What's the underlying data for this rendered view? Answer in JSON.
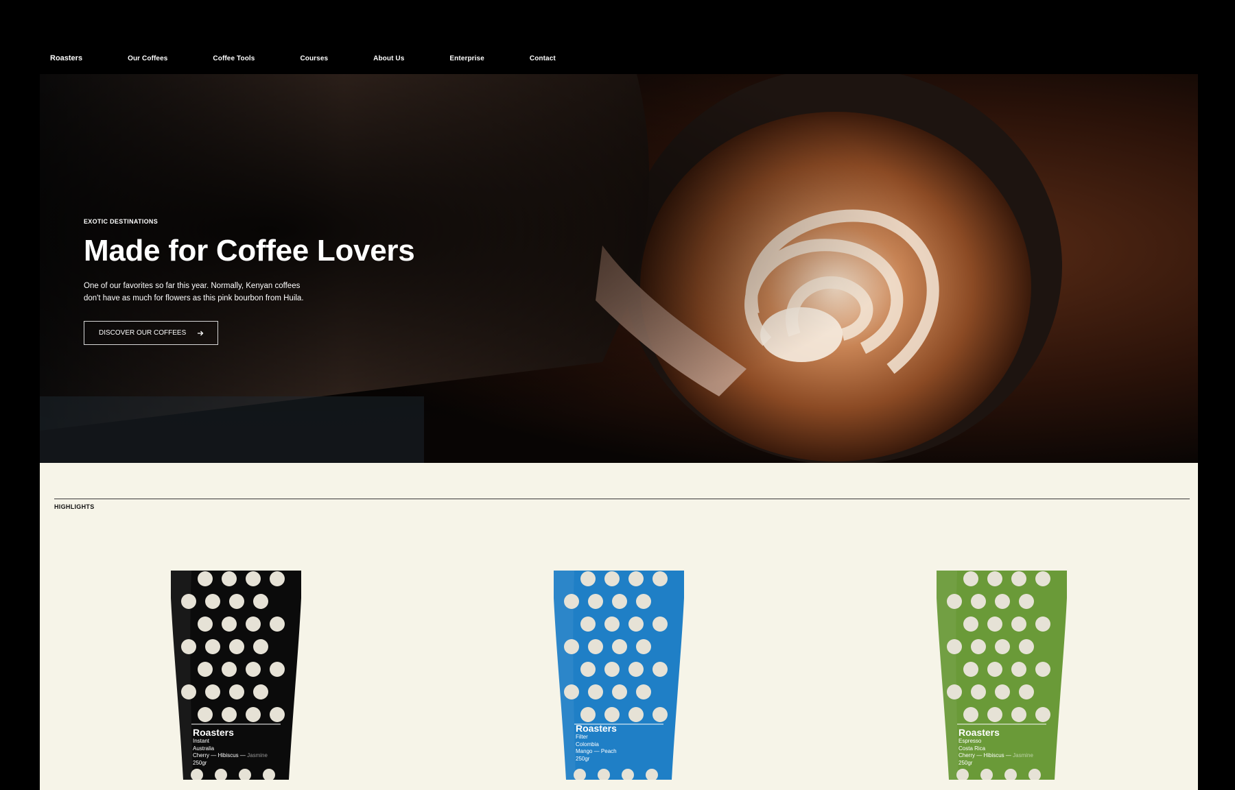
{
  "nav": {
    "brand": "Roasters",
    "items": [
      "Our Coffees",
      "Coffee Tools",
      "Courses",
      "About Us",
      "Enterprise",
      "Contact"
    ]
  },
  "hero": {
    "eyebrow": "EXOTIC DESTINATIONS",
    "title": "Made for Coffee Lovers",
    "description_line1": "One of our favorites so far this year. Normally, Kenyan coffees",
    "description_line2": "don't have as much for flowers as this pink bourbon from Huila.",
    "cta_label": "DISCOVER OUR COFFEES"
  },
  "highlights": {
    "label": "HIGHLIGHTS",
    "products": [
      {
        "brand": "Roasters",
        "type": "Instant",
        "origin": "Australia",
        "notes_main": "Cherry — Hibiscus — ",
        "notes_faint": "Jasmine",
        "weight": "250gr",
        "color": "#0b0b0b"
      },
      {
        "brand": "Roasters",
        "type": "Filter",
        "origin": "Colombia",
        "notes_main": "Mango — Peach",
        "notes_faint": "",
        "weight": "250gr",
        "color": "#1f7fc6"
      },
      {
        "brand": "Roasters",
        "type": "Espresso",
        "origin": "Costa Rica",
        "notes_main": "Cherry — Hibiscus — ",
        "notes_faint": "Jasmine",
        "weight": "250gr",
        "color": "#6a9a38"
      }
    ]
  },
  "colors": {
    "background": "#000000",
    "cream": "#f6f4e8",
    "dots": "#e6e2d6"
  },
  "icons": {
    "cta_icon": "arrow-right-icon"
  }
}
